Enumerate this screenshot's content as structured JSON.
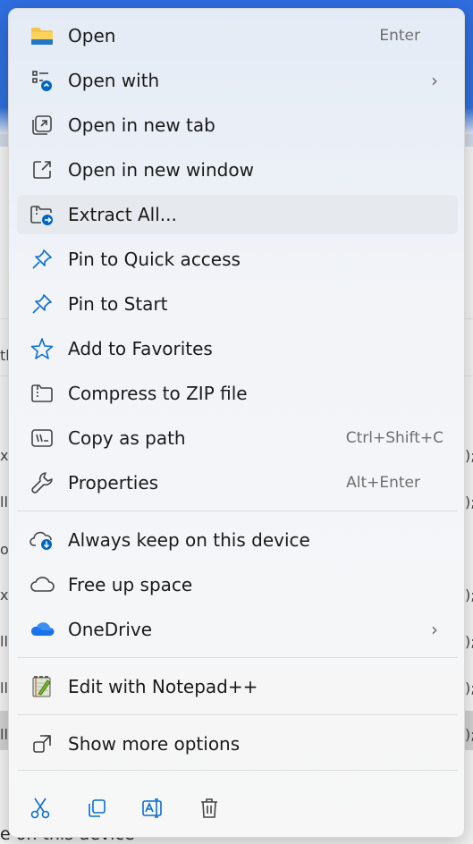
{
  "menu": {
    "items": [
      {
        "label": "Open",
        "shortcut": "Enter"
      },
      {
        "label": "Open with"
      },
      {
        "label": "Open in new tab"
      },
      {
        "label": "Open in new window"
      },
      {
        "label": "Extract All..."
      },
      {
        "label": "Pin to Quick access"
      },
      {
        "label": "Pin to Start"
      },
      {
        "label": "Add to Favorites"
      },
      {
        "label": "Compress to ZIP file"
      },
      {
        "label": "Copy as path",
        "shortcut": "Ctrl+Shift+C"
      },
      {
        "label": "Properties",
        "shortcut": "Alt+Enter"
      },
      {
        "label": "Always keep on this device"
      },
      {
        "label": "Free up space"
      },
      {
        "label": "OneDrive"
      },
      {
        "label": "Edit with Notepad++"
      },
      {
        "label": "Show more options"
      }
    ],
    "submenu_chevron": "›",
    "hover_index": 4,
    "actions": [
      "cut-icon",
      "copy-icon",
      "rename-icon",
      "delete-icon"
    ]
  },
  "background": {
    "left_fragments": [
      "tl",
      "xi",
      "ll",
      "o",
      "x",
      "ll",
      "ll",
      "ll"
    ],
    "right_fragments": [
      ");",
      ");",
      ");",
      ");",
      ");",
      ");"
    ],
    "bottom_text": "e on this device"
  },
  "colors": {
    "accent": "#0067c0",
    "onedrive": "#1a73e8",
    "folder": "#f4b400"
  }
}
